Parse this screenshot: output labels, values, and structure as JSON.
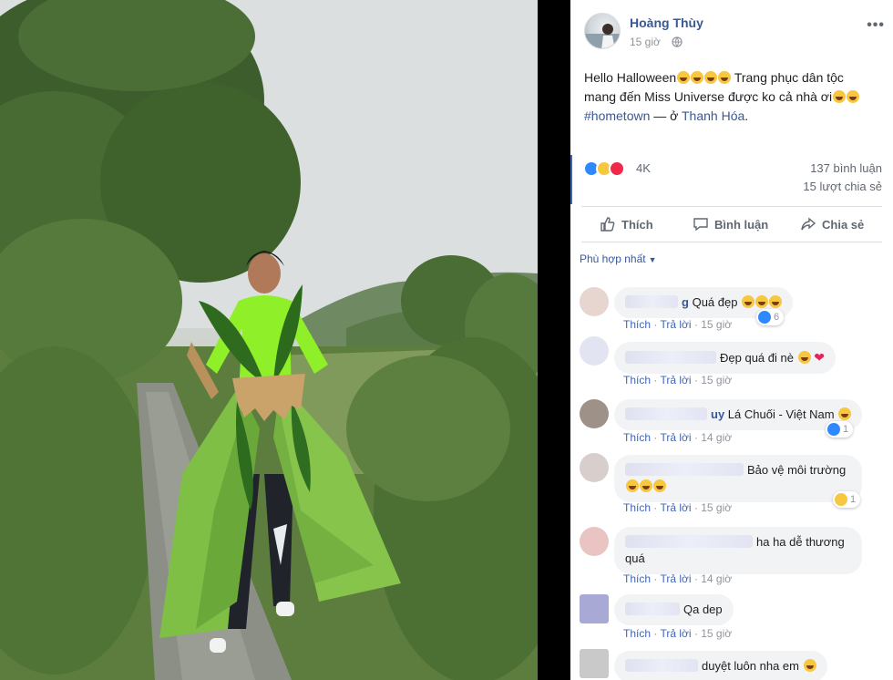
{
  "post": {
    "author": "Hoàng Thùy",
    "time": "15 giờ",
    "text_line1": "Hello Halloween",
    "text_line1_tail": "Trang phục dân tộc",
    "text_line2": "mang đến Miss Universe được ko cả nhà ơi",
    "hashtag": "#hometown",
    "location_sep": " — ở ",
    "location": "Thanh Hóa",
    "location_end": "."
  },
  "stats": {
    "reaction_count": "4K",
    "comments": "137 bình luận",
    "shares": "15 lượt chia sẻ"
  },
  "actions": {
    "like": "Thích",
    "comment": "Bình luận",
    "share": "Chia sẻ"
  },
  "sort": {
    "label": "Phù hợp nhất"
  },
  "comment_actions": {
    "like": "Thích",
    "reply": "Trả lời"
  },
  "comments": [
    {
      "name_tail": "g",
      "text": "Quá đẹp",
      "time": "15 giờ",
      "reaction_count": "6"
    },
    {
      "name_tail": "",
      "text": "Đẹp quá đi nè",
      "time": "15 giờ",
      "reaction_count": ""
    },
    {
      "name_tail": "uy",
      "text": "Lá Chuối - Việt Nam",
      "time": "14 giờ",
      "reaction_count": "1"
    },
    {
      "name_tail": "",
      "text": "Bảo vệ môi trường",
      "time": "15 giờ",
      "reaction_count": "1"
    },
    {
      "name_tail": "",
      "text": "ha ha dễ thương quá",
      "time": "14 giờ",
      "reaction_count": ""
    },
    {
      "name_tail": "",
      "text": "Qa dep",
      "time": "15 giờ",
      "reaction_count": ""
    },
    {
      "name_tail": "",
      "text": "duyệt luôn nha em",
      "time": "",
      "reaction_count": ""
    }
  ],
  "icons": {
    "globe": "globe-icon",
    "more": "more-icon",
    "like": "thumbs-up-icon",
    "comment": "speech-bubble-icon",
    "share": "share-arrow-icon"
  },
  "colors": {
    "link": "#385898",
    "accent": "#4267b2",
    "muted": "#90949c",
    "bubble": "#f2f3f5"
  }
}
